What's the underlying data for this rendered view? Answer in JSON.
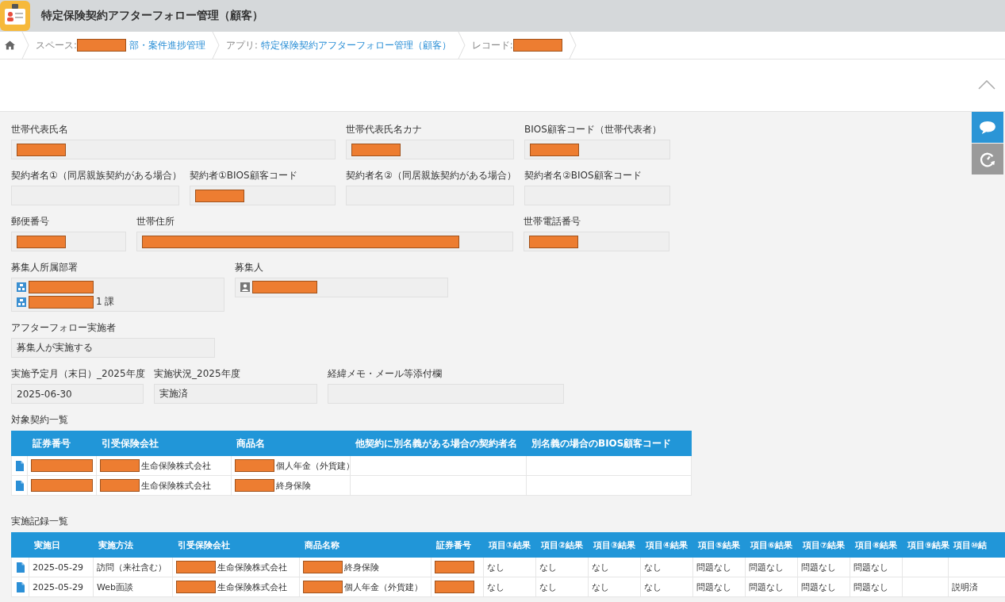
{
  "header": {
    "title": "特定保険契約アフターフォロー管理（顧客）"
  },
  "breadcrumb": [
    {
      "kind": "home"
    },
    {
      "kind": "crumb",
      "label": "スペース:",
      "redacted": true,
      "link": "部・案件進捗管理"
    },
    {
      "kind": "crumb",
      "label": "アプリ:",
      "link": "特定保険契約アフターフォロー管理（顧客）"
    },
    {
      "kind": "crumb",
      "label": "レコード:",
      "redacted": true
    }
  ],
  "side_buttons": [
    {
      "kind": "comment"
    },
    {
      "kind": "history"
    }
  ],
  "form_rows": [
    [
      {
        "kind": "text",
        "label": "世帯代表氏名",
        "redacted": true
      },
      {
        "kind": "text",
        "label": "世帯代表氏名カナ",
        "redacted": true
      },
      {
        "kind": "text",
        "label": "BIOS顧客コード（世帯代表者）",
        "redacted": true
      }
    ],
    [
      {
        "kind": "text",
        "label": "契約者名①（同居親族契約がある場合）"
      },
      {
        "kind": "text",
        "label": "契約者①BIOS顧客コード",
        "redacted": true
      },
      {
        "kind": "text",
        "label": "契約者名②（同居親族契約がある場合）"
      },
      {
        "kind": "text",
        "label": "契約者名②BIOS顧客コード"
      }
    ],
    [
      {
        "kind": "text",
        "label": "郵便番号",
        "redacted": true
      },
      {
        "kind": "text",
        "label": "世帯住所",
        "redacted": true
      },
      {
        "kind": "text",
        "label": "世帯電話番号",
        "redacted": true
      }
    ],
    [
      {
        "kind": "org",
        "label": "募集人所属部署",
        "entries": [
          {
            "redacted": true
          },
          {
            "redacted": true,
            "text": "1 課"
          }
        ]
      },
      {
        "kind": "user",
        "label": "募集人",
        "entries": [
          {
            "redacted": true
          }
        ]
      }
    ],
    [
      {
        "kind": "text",
        "label": "アフターフォロー実施者",
        "value": "募集人が実施する"
      }
    ],
    [
      {
        "kind": "text",
        "label": "実施予定月（末日）_2025年度",
        "value": "2025-06-30"
      },
      {
        "kind": "text",
        "label": "実施状況_2025年度",
        "value": "実施済"
      },
      {
        "kind": "text",
        "label": "経緯メモ・メール等添付欄"
      }
    ]
  ],
  "tables": [
    {
      "title": "対象契約一覧",
      "columns": [
        "証券番号",
        "引受保険会社",
        "商品名",
        "他契約に別名義がある場合の契約者名",
        "別名義の場合のBIOS顧客コード"
      ],
      "rows": [
        [
          {
            "redacted": true
          },
          {
            "redacted": true,
            "text": "生命保険株式会社"
          },
          {
            "redacted": true,
            "text": "個人年金（外貨建）"
          },
          null,
          null
        ],
        [
          {
            "redacted": true
          },
          {
            "redacted": true,
            "text": "生命保険株式会社"
          },
          {
            "redacted": true,
            "text": "終身保険"
          },
          null,
          null
        ]
      ]
    },
    {
      "title": "実施記録一覧",
      "columns": [
        "実施日",
        "実施方法",
        "引受保険会社",
        "商品名称",
        "証券番号",
        "項目①結果",
        "項目②結果",
        "項目③結果",
        "項目④結果",
        "項目⑤結果",
        "項目⑥結果",
        "項目⑦結果",
        "項目⑧結果",
        "項目⑨結果",
        "項目⑩結"
      ],
      "rows": [
        [
          {
            "text": "2025-05-29"
          },
          {
            "text": "訪問（来社含む）"
          },
          {
            "redacted": true,
            "text": "生命保険株式会社"
          },
          {
            "redacted": true,
            "text": "終身保険"
          },
          {
            "redacted": true
          },
          {
            "text": "なし"
          },
          {
            "text": "なし"
          },
          {
            "text": "なし"
          },
          {
            "text": "なし"
          },
          {
            "text": "問題なし"
          },
          {
            "text": "問題なし"
          },
          {
            "text": "問題なし"
          },
          {
            "text": "問題なし"
          },
          null,
          null
        ],
        [
          {
            "text": "2025-05-29"
          },
          {
            "text": "Web面談"
          },
          {
            "redacted": true,
            "text": "生命保険株式会社"
          },
          {
            "redacted": true,
            "text": "個人年金（外貨建）"
          },
          {
            "redacted": true
          },
          {
            "text": "なし"
          },
          {
            "text": "なし"
          },
          {
            "text": "なし"
          },
          {
            "text": "なし"
          },
          {
            "text": "問題なし"
          },
          {
            "text": "問題なし"
          },
          {
            "text": "問題なし"
          },
          {
            "text": "問題なし"
          },
          null,
          {
            "text": "説明済"
          }
        ]
      ]
    }
  ]
}
